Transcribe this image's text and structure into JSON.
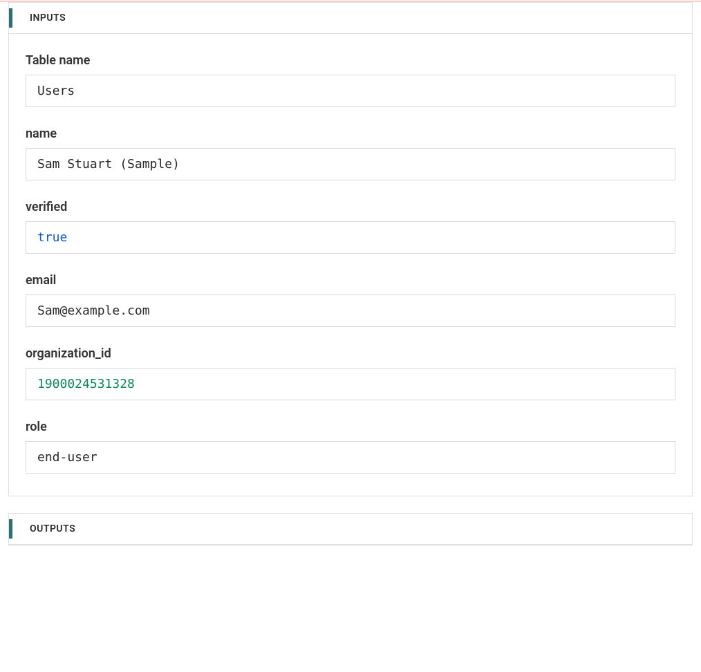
{
  "sections": {
    "inputs": {
      "title": "INPUTS",
      "fields": {
        "table_name": {
          "label": "Table name",
          "value": "Users",
          "type": "string"
        },
        "name": {
          "label": "name",
          "value": "Sam Stuart (Sample)",
          "type": "string"
        },
        "verified": {
          "label": "verified",
          "value": "true",
          "type": "bool"
        },
        "email": {
          "label": "email",
          "value": "Sam@example.com",
          "type": "string"
        },
        "organization_id": {
          "label": "organization_id",
          "value": "1900024531328",
          "type": "number"
        },
        "role": {
          "label": "role",
          "value": "end-user",
          "type": "string"
        }
      }
    },
    "outputs": {
      "title": "OUTPUTS"
    }
  }
}
